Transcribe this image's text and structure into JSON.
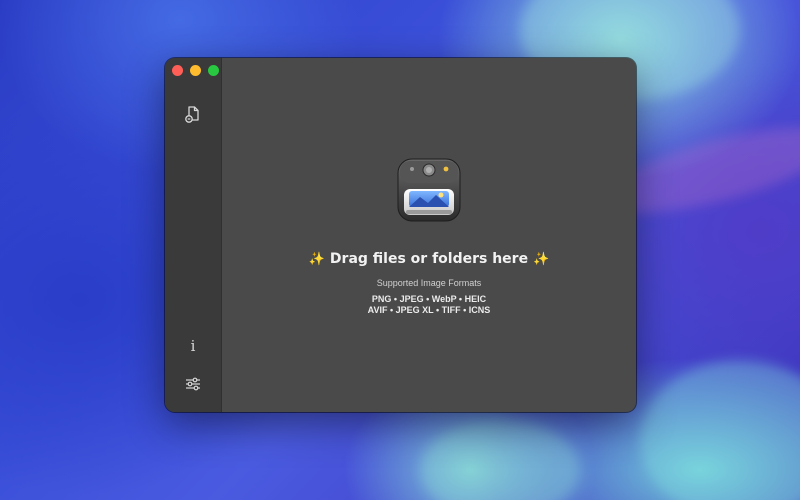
{
  "window": {
    "controls": [
      "close",
      "minimize",
      "zoom"
    ]
  },
  "sidebar": {
    "top_icon": "file-open-icon",
    "info_icon": "info-icon",
    "info_glyph": "i",
    "settings_icon": "sliders-icon"
  },
  "drop_zone": {
    "sparkle_left": "✨",
    "title": "Drag files or folders here",
    "sparkle_right": "✨",
    "formats_label": "Supported Image Formats",
    "formats_line1": "PNG • JPEG • WebP • HEIC",
    "formats_line2": "AVIF • JPEG XL • TIFF • ICNS"
  },
  "colors": {
    "window_bg": "#4a4a4a",
    "sidebar_bg": "#3a3a3a",
    "close": "#ff5f57",
    "minimize": "#febc2e",
    "zoom": "#28c840"
  }
}
